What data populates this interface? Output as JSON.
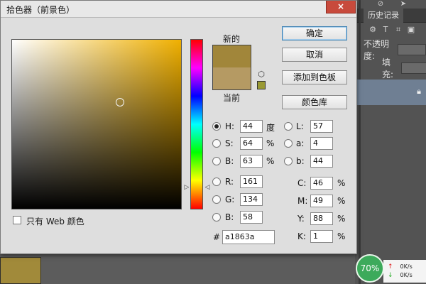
{
  "dialog": {
    "title": "拾色器（前景色）",
    "close_icon": "×"
  },
  "colors": {
    "new": "#a1863a",
    "current": "#b59a63",
    "web_safe": "#999933"
  },
  "labels": {
    "new": "新的",
    "current": "当前"
  },
  "buttons": {
    "ok": "确定",
    "cancel": "取消",
    "add_swatch": "添加到色板",
    "color_library": "颜色库"
  },
  "hsb": {
    "h_label": "H:",
    "h_value": "44",
    "h_unit": "度",
    "s_label": "S:",
    "s_value": "64",
    "s_unit": "%",
    "b_label": "B:",
    "b_value": "63",
    "b_unit": "%"
  },
  "lab": {
    "l_label": "L:",
    "l_value": "57",
    "a_label": "a:",
    "a_value": "4",
    "b_label": "b:",
    "b_value": "44"
  },
  "rgb": {
    "r_label": "R:",
    "r_value": "161",
    "g_label": "G:",
    "g_value": "134",
    "b_label": "B:",
    "b_value": "58"
  },
  "cmyk": {
    "c_label": "C:",
    "c_value": "46",
    "c_unit": "%",
    "m_label": "M:",
    "m_value": "49",
    "m_unit": "%",
    "y_label": "Y:",
    "y_value": "88",
    "y_unit": "%",
    "k_label": "K:",
    "k_value": "1",
    "k_unit": "%"
  },
  "hex": {
    "label": "#",
    "value": "a1863a"
  },
  "web_only": {
    "label": "只有 Web 颜色"
  },
  "background_panel": {
    "history_tab": "历史记录",
    "opacity_label": "不透明度:",
    "fill_label": "填充:"
  },
  "system": {
    "cpu_percent": "70%",
    "upload_speed": "0K/s",
    "download_speed": "0K/s"
  }
}
